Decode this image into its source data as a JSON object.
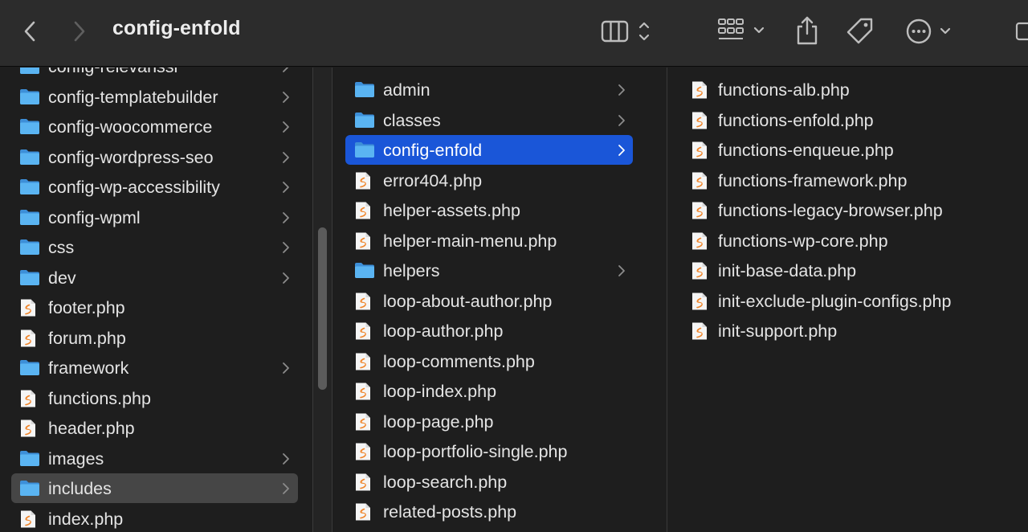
{
  "window": {
    "title": "config-enfold"
  },
  "toolbar": {
    "icons": [
      "chevron-left-icon",
      "chevron-right-icon",
      "columns-view-icon",
      "group-grid-icon",
      "share-icon",
      "tag-icon",
      "more-icon",
      "sidebar-icon"
    ]
  },
  "colors": {
    "folder": "#4aa3e8",
    "selection_active": "#1a56d8",
    "selection_inactive": "#464646",
    "php_accent": "#f0852a"
  },
  "columns": [
    {
      "items": [
        {
          "name": "config-relevanssi",
          "type": "folder",
          "partial": true
        },
        {
          "name": "config-templatebuilder",
          "type": "folder"
        },
        {
          "name": "config-woocommerce",
          "type": "folder"
        },
        {
          "name": "config-wordpress-seo",
          "type": "folder"
        },
        {
          "name": "config-wp-accessibility",
          "type": "folder"
        },
        {
          "name": "config-wpml",
          "type": "folder"
        },
        {
          "name": "css",
          "type": "folder"
        },
        {
          "name": "dev",
          "type": "folder"
        },
        {
          "name": "footer.php",
          "type": "php"
        },
        {
          "name": "forum.php",
          "type": "php"
        },
        {
          "name": "framework",
          "type": "folder"
        },
        {
          "name": "functions.php",
          "type": "php"
        },
        {
          "name": "header.php",
          "type": "php"
        },
        {
          "name": "images",
          "type": "folder"
        },
        {
          "name": "includes",
          "type": "folder",
          "selected": "inactive"
        },
        {
          "name": "index.php",
          "type": "php"
        }
      ]
    },
    {
      "items": [
        {
          "name": "admin",
          "type": "folder"
        },
        {
          "name": "classes",
          "type": "folder"
        },
        {
          "name": "config-enfold",
          "type": "folder",
          "selected": "active"
        },
        {
          "name": "error404.php",
          "type": "php"
        },
        {
          "name": "helper-assets.php",
          "type": "php"
        },
        {
          "name": "helper-main-menu.php",
          "type": "php"
        },
        {
          "name": "helpers",
          "type": "folder"
        },
        {
          "name": "loop-about-author.php",
          "type": "php"
        },
        {
          "name": "loop-author.php",
          "type": "php"
        },
        {
          "name": "loop-comments.php",
          "type": "php"
        },
        {
          "name": "loop-index.php",
          "type": "php"
        },
        {
          "name": "loop-page.php",
          "type": "php"
        },
        {
          "name": "loop-portfolio-single.php",
          "type": "php"
        },
        {
          "name": "loop-search.php",
          "type": "php"
        },
        {
          "name": "related-posts.php",
          "type": "php"
        }
      ]
    },
    {
      "items": [
        {
          "name": "functions-alb.php",
          "type": "php"
        },
        {
          "name": "functions-enfold.php",
          "type": "php"
        },
        {
          "name": "functions-enqueue.php",
          "type": "php"
        },
        {
          "name": "functions-framework.php",
          "type": "php"
        },
        {
          "name": "functions-legacy-browser.php",
          "type": "php"
        },
        {
          "name": "functions-wp-core.php",
          "type": "php"
        },
        {
          "name": "init-base-data.php",
          "type": "php"
        },
        {
          "name": "init-exclude-plugin-configs.php",
          "type": "php"
        },
        {
          "name": "init-support.php",
          "type": "php"
        }
      ]
    }
  ]
}
